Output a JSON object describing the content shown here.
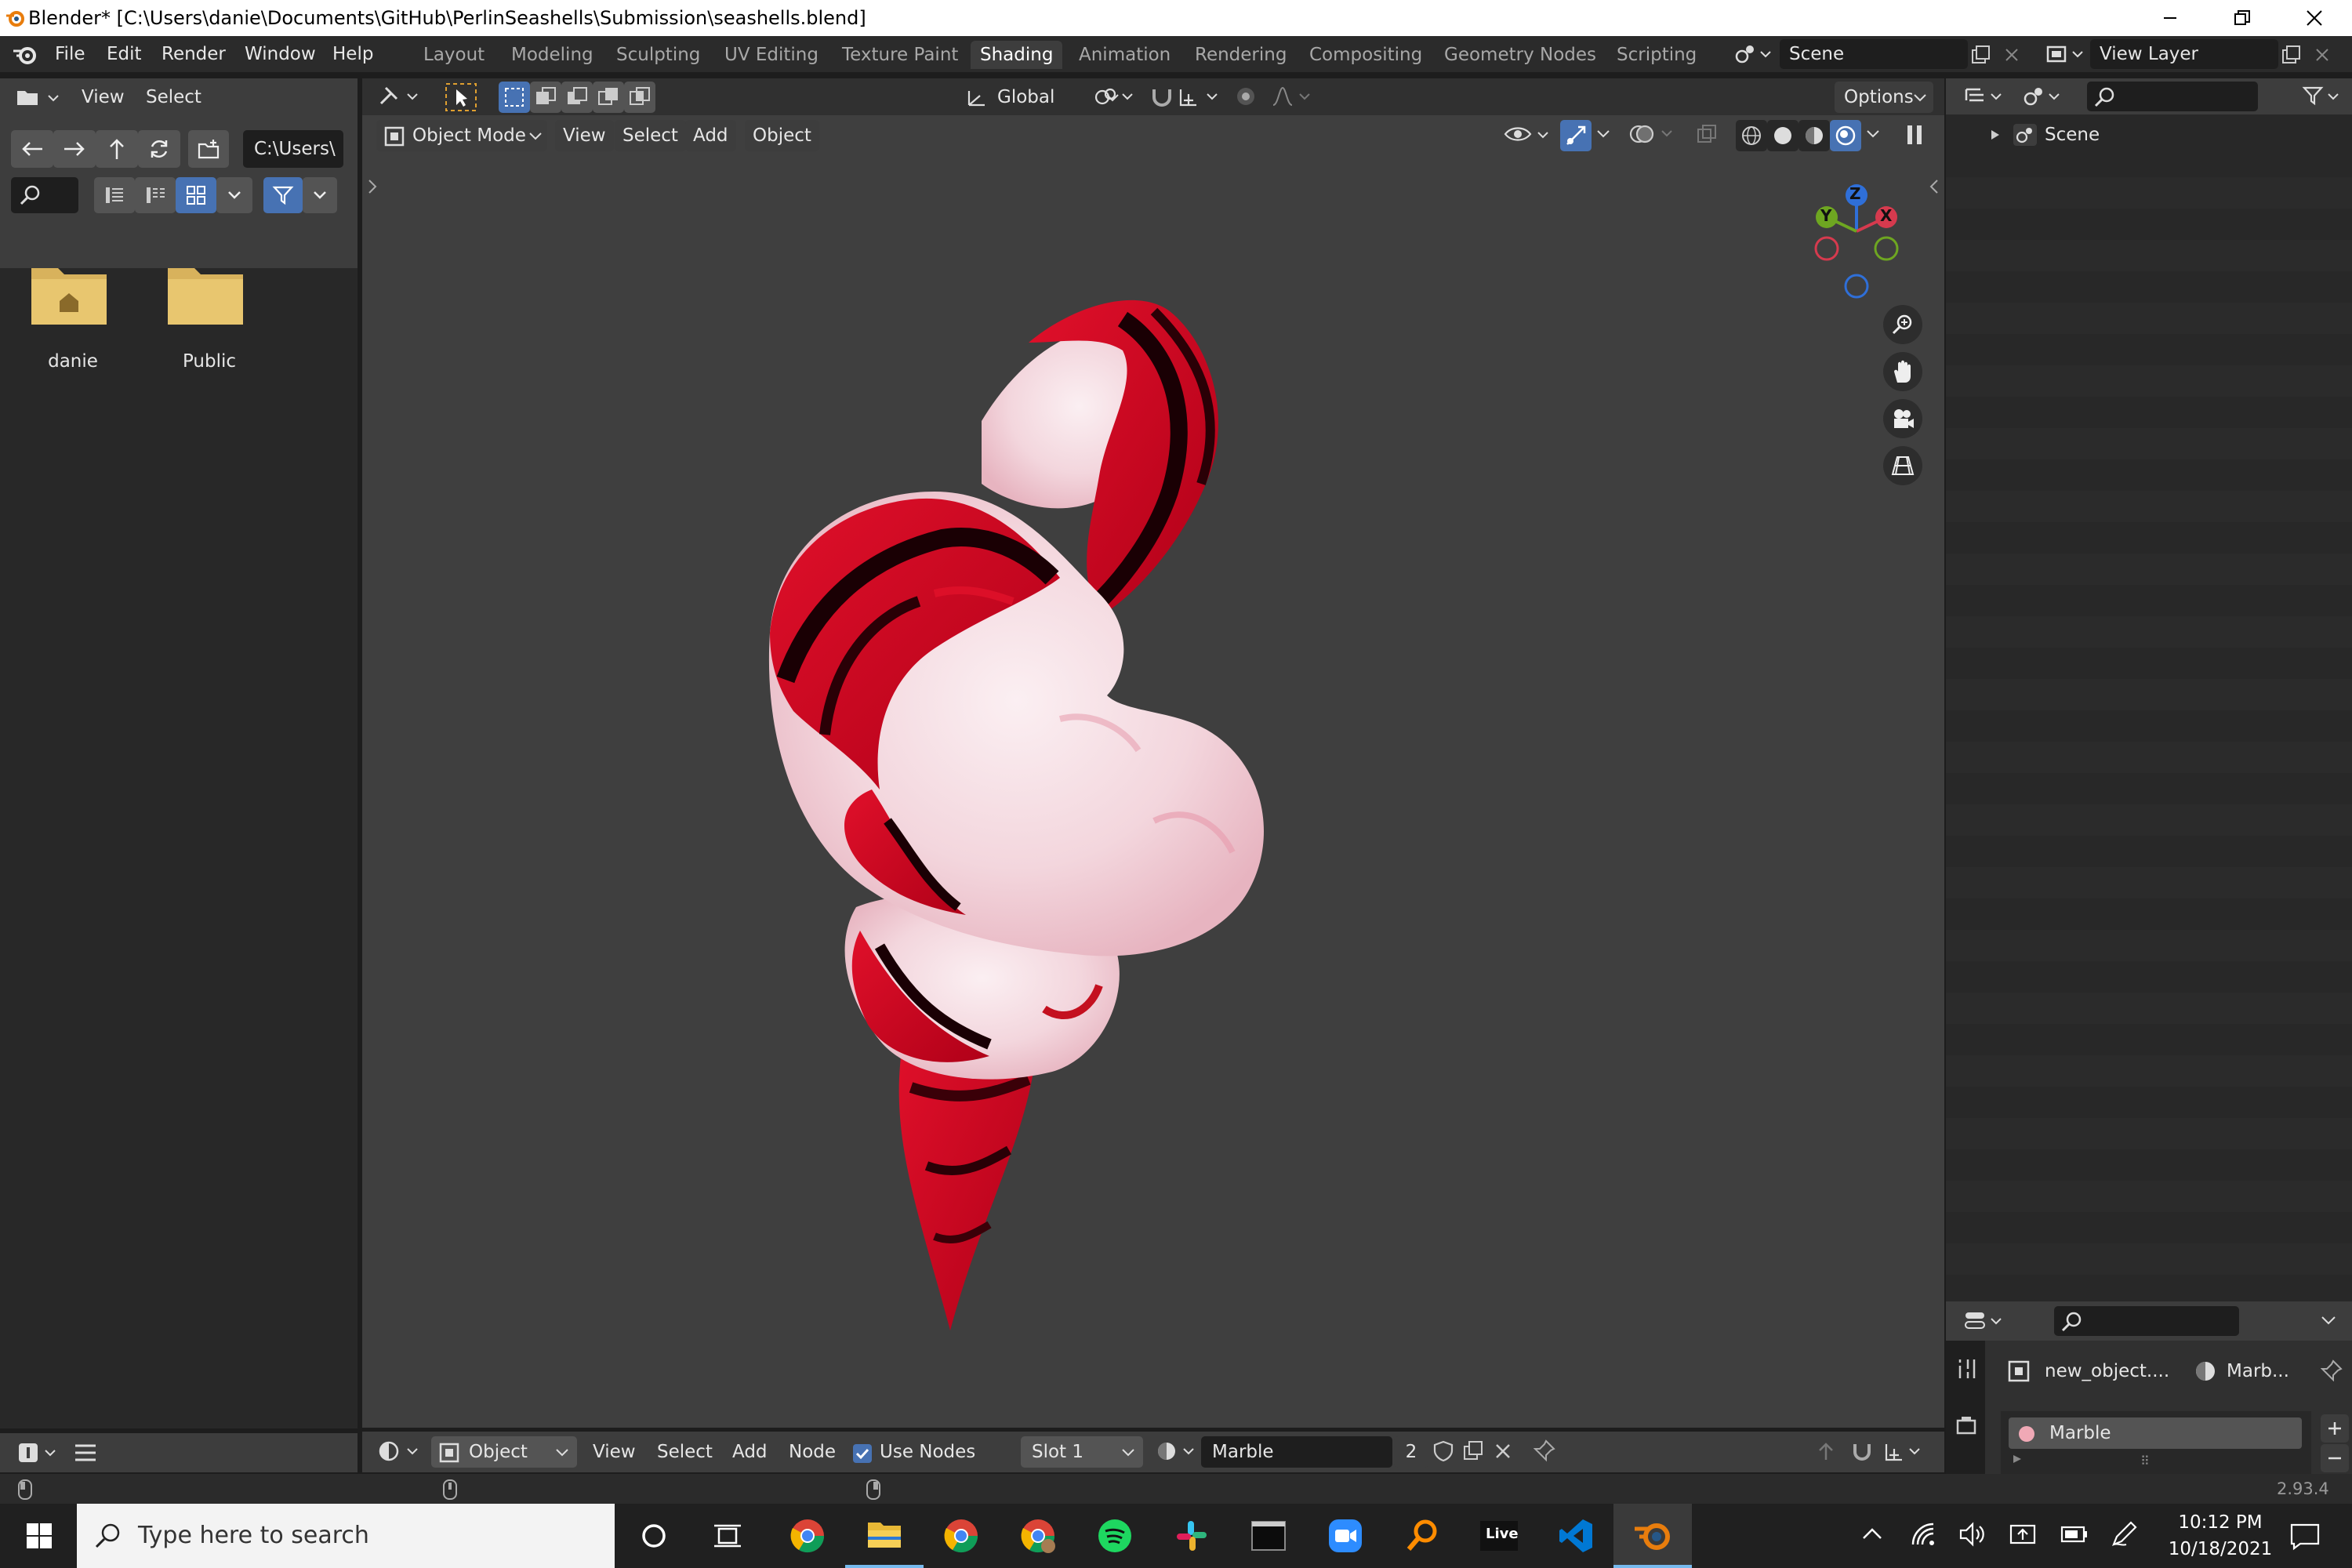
{
  "window": {
    "title": "Blender* [C:\\Users\\danie\\Documents\\GitHub\\PerlinSeashells\\Submission\\seashells.blend]"
  },
  "menu": {
    "file": "File",
    "edit": "Edit",
    "render": "Render",
    "window": "Window",
    "help": "Help"
  },
  "workspaces": [
    "Layout",
    "Modeling",
    "Sculpting",
    "UV Editing",
    "Texture Paint",
    "Shading",
    "Animation",
    "Rendering",
    "Compositing",
    "Geometry Nodes",
    "Scripting"
  ],
  "active_workspace": "Shading",
  "scene": {
    "name": "Scene"
  },
  "view_layer": {
    "name": "View Layer"
  },
  "file_browser": {
    "view_label": "View",
    "select_label": "Select",
    "path": "C:\\Users\\",
    "folders": [
      {
        "name": "danie",
        "icon": "home-folder-icon"
      },
      {
        "name": "Public",
        "icon": "folder-icon"
      }
    ]
  },
  "viewport": {
    "mode": "Object Mode",
    "view": "View",
    "select": "Select",
    "add": "Add",
    "object": "Object",
    "orientation": "Global",
    "options": "Options",
    "gizmo": {
      "x": "X",
      "y": "Y",
      "z": "Z"
    }
  },
  "outliner": {
    "scene_item": "Scene"
  },
  "node_editor": {
    "type": "Object",
    "view": "View",
    "select": "Select",
    "add": "Add",
    "node": "Node",
    "use_nodes_label": "Use Nodes",
    "use_nodes_checked": true,
    "slot": "Slot 1",
    "material": "Marble",
    "users": "2"
  },
  "properties": {
    "object_name": "new_object....",
    "material_short": "Marb...",
    "material_slot": "Marble"
  },
  "status": {
    "version": "2.93.4"
  },
  "taskbar": {
    "search_placeholder": "Type here to search",
    "time": "10:12 PM",
    "date": "10/18/2021",
    "live_label": "Live"
  },
  "colors": {
    "accent_blue": "#4772b3",
    "shell_red": "#d0101e",
    "shell_pink": "#f5dde3",
    "folder_yellow": "#e8c66f"
  }
}
